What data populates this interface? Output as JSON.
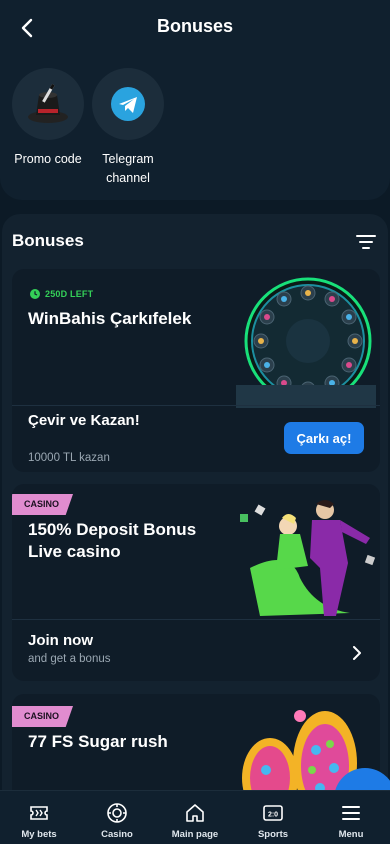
{
  "header": {
    "title": "Bonuses"
  },
  "quick_actions": [
    {
      "label": "Promo code",
      "icon": "magic-hat-icon"
    },
    {
      "label": "Telegram channel",
      "icon": "telegram-icon"
    }
  ],
  "section": {
    "title": "Bonuses"
  },
  "cards": [
    {
      "timer": "250D LEFT",
      "title": "WinBahis Çarkıfelek",
      "subtitle": "Çevir ve Kazan!",
      "note": "10000 TL kazan",
      "button": "Çarkı aç!"
    },
    {
      "tag": "CASINO",
      "title_line1": "150% Deposit Bonus",
      "title_line2": "Live casino",
      "action": "Join now",
      "action_sub": "and get a bonus"
    },
    {
      "tag": "CASINO",
      "title": "77 FS Sugar rush"
    }
  ],
  "nav": [
    {
      "label": "My bets",
      "icon": "ticket-icon"
    },
    {
      "label": "Casino",
      "icon": "casino-chip-icon"
    },
    {
      "label": "Main page",
      "icon": "home-icon"
    },
    {
      "label": "Sports",
      "icon": "scoreboard-icon"
    },
    {
      "label": "Menu",
      "icon": "hamburger-icon"
    }
  ],
  "colors": {
    "background": "#0c1a26",
    "card": "#0f1c28",
    "accent_blue": "#1e7be6",
    "timer_green": "#34d058",
    "tag_pink": "#e08ccf"
  }
}
